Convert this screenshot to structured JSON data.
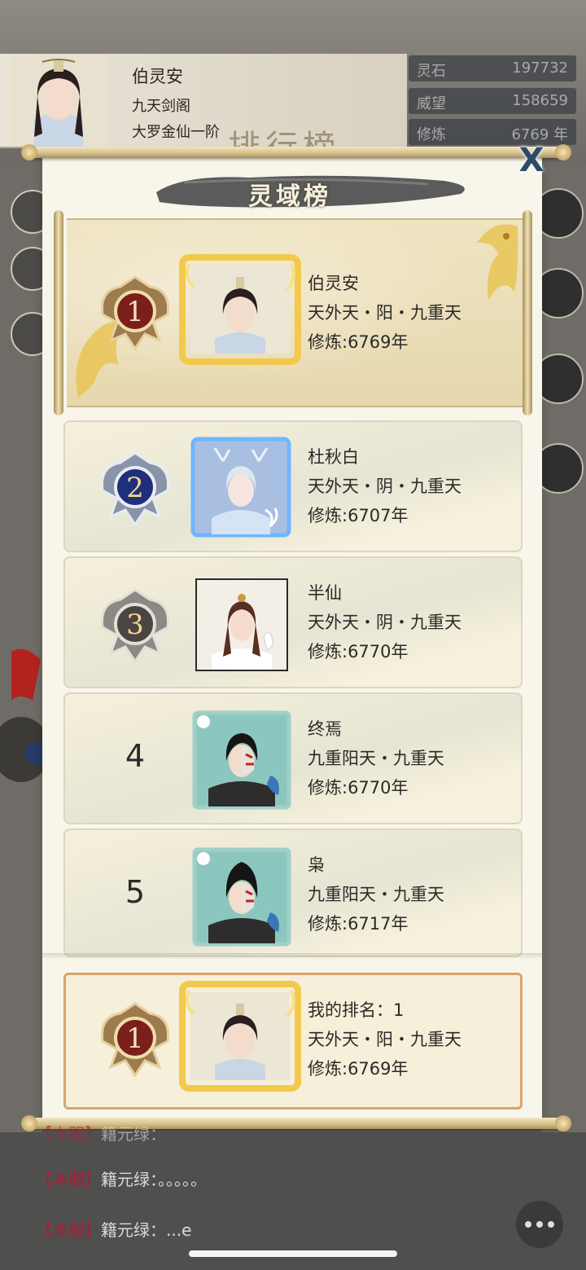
{
  "player": {
    "name": "伯灵安",
    "sect": "九天剑阁",
    "realm": "大罗金仙一阶"
  },
  "background_title": "排行榜",
  "stats": [
    {
      "label": "灵石",
      "value": "197732"
    },
    {
      "label": "威望",
      "value": "158659"
    },
    {
      "label": "修炼",
      "value": "6769 年"
    }
  ],
  "panel": {
    "title": "灵域榜",
    "close_label": "X"
  },
  "rankings": [
    {
      "rank": "1",
      "name": "伯灵安",
      "realm": "天外天・阳・九重天",
      "cultivation": "修炼:6769年",
      "frame": "gold",
      "medal": "gold"
    },
    {
      "rank": "2",
      "name": "杜秋白",
      "realm": "天外天・阴・九重天",
      "cultivation": "修炼:6707年",
      "frame": "blue",
      "medal": "silver-blue"
    },
    {
      "rank": "3",
      "name": "半仙",
      "realm": "天外天・阴・九重天",
      "cultivation": "修炼:6770年",
      "frame": "plain",
      "medal": "bronze"
    },
    {
      "rank": "4",
      "name": "终焉",
      "realm": "九重阳天・九重天",
      "cultivation": "修炼:6770年",
      "frame": "teal",
      "medal": "none"
    },
    {
      "rank": "5",
      "name": "枭",
      "realm": "九重阳天・九重天",
      "cultivation": "修炼:6717年",
      "frame": "teal",
      "medal": "none"
    }
  ],
  "my_rank": {
    "rank": "1",
    "label": "我的排名：1",
    "realm": "天外天・阳・九重天",
    "cultivation": "修炼:6769年"
  },
  "chat": [
    {
      "tag": "【本服】",
      "text": "籍元绿：。。。。。"
    },
    {
      "tag": "【本服】",
      "text": "籍元绿：...e"
    }
  ],
  "chat_partial": {
    "tag": "【本服】",
    "text": "籍元绿："
  },
  "colors": {
    "gold_frame": "#f2c94c",
    "blue_frame": "#6fb6ff",
    "teal_frame": "#9fd0c7",
    "panel_bg": "#f8f6ea",
    "chat_tag": "#a3213a"
  }
}
